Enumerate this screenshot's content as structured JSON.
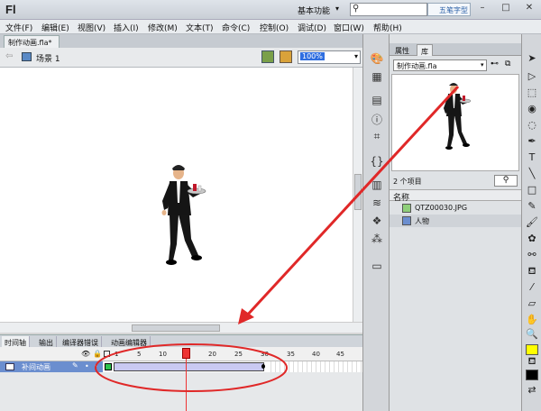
{
  "app": {
    "logo": "Fl"
  },
  "topbar": {
    "workspace": "基本功能",
    "workspace_arrow": "▾",
    "watermark": "五笔字型"
  },
  "window_controls": {
    "minimize": "–",
    "maximize": "□",
    "close": "✕"
  },
  "menu": [
    "文件(F)",
    "编辑(E)",
    "视图(V)",
    "插入(I)",
    "修改(M)",
    "文本(T)",
    "命令(C)",
    "控制(O)",
    "调试(D)",
    "窗口(W)",
    "帮助(H)"
  ],
  "document": {
    "tab_label": "制作动画.fla*"
  },
  "scene": {
    "label": "场景 1"
  },
  "zoom": {
    "value": "100%"
  },
  "timeline": {
    "tabs": [
      "时间轴",
      "输出",
      "编译器错误",
      "动画编辑器"
    ],
    "ruler_ticks": [
      "1",
      "5",
      "10",
      "15",
      "20",
      "25",
      "30",
      "35",
      "40",
      "45"
    ],
    "layer_name": "补间动画",
    "current_frame": 15
  },
  "library": {
    "tabs": [
      "属性",
      "库"
    ],
    "file_select": "制作动画.fla",
    "item_count": "2 个项目",
    "column_name": "名称",
    "items": [
      {
        "name": "QTZ00030.JPG",
        "icon": "bitmap-icon"
      },
      {
        "name": "人物",
        "icon": "movieclip-icon"
      }
    ]
  },
  "colors": {
    "accent_selection": "#2f6ee0",
    "annotation_red": "#e02828",
    "layer_highlight": "#6b8ecf",
    "keyframe_green": "#2ec34e",
    "stroke_color": "#ffff00",
    "fill_color": "#000000"
  }
}
